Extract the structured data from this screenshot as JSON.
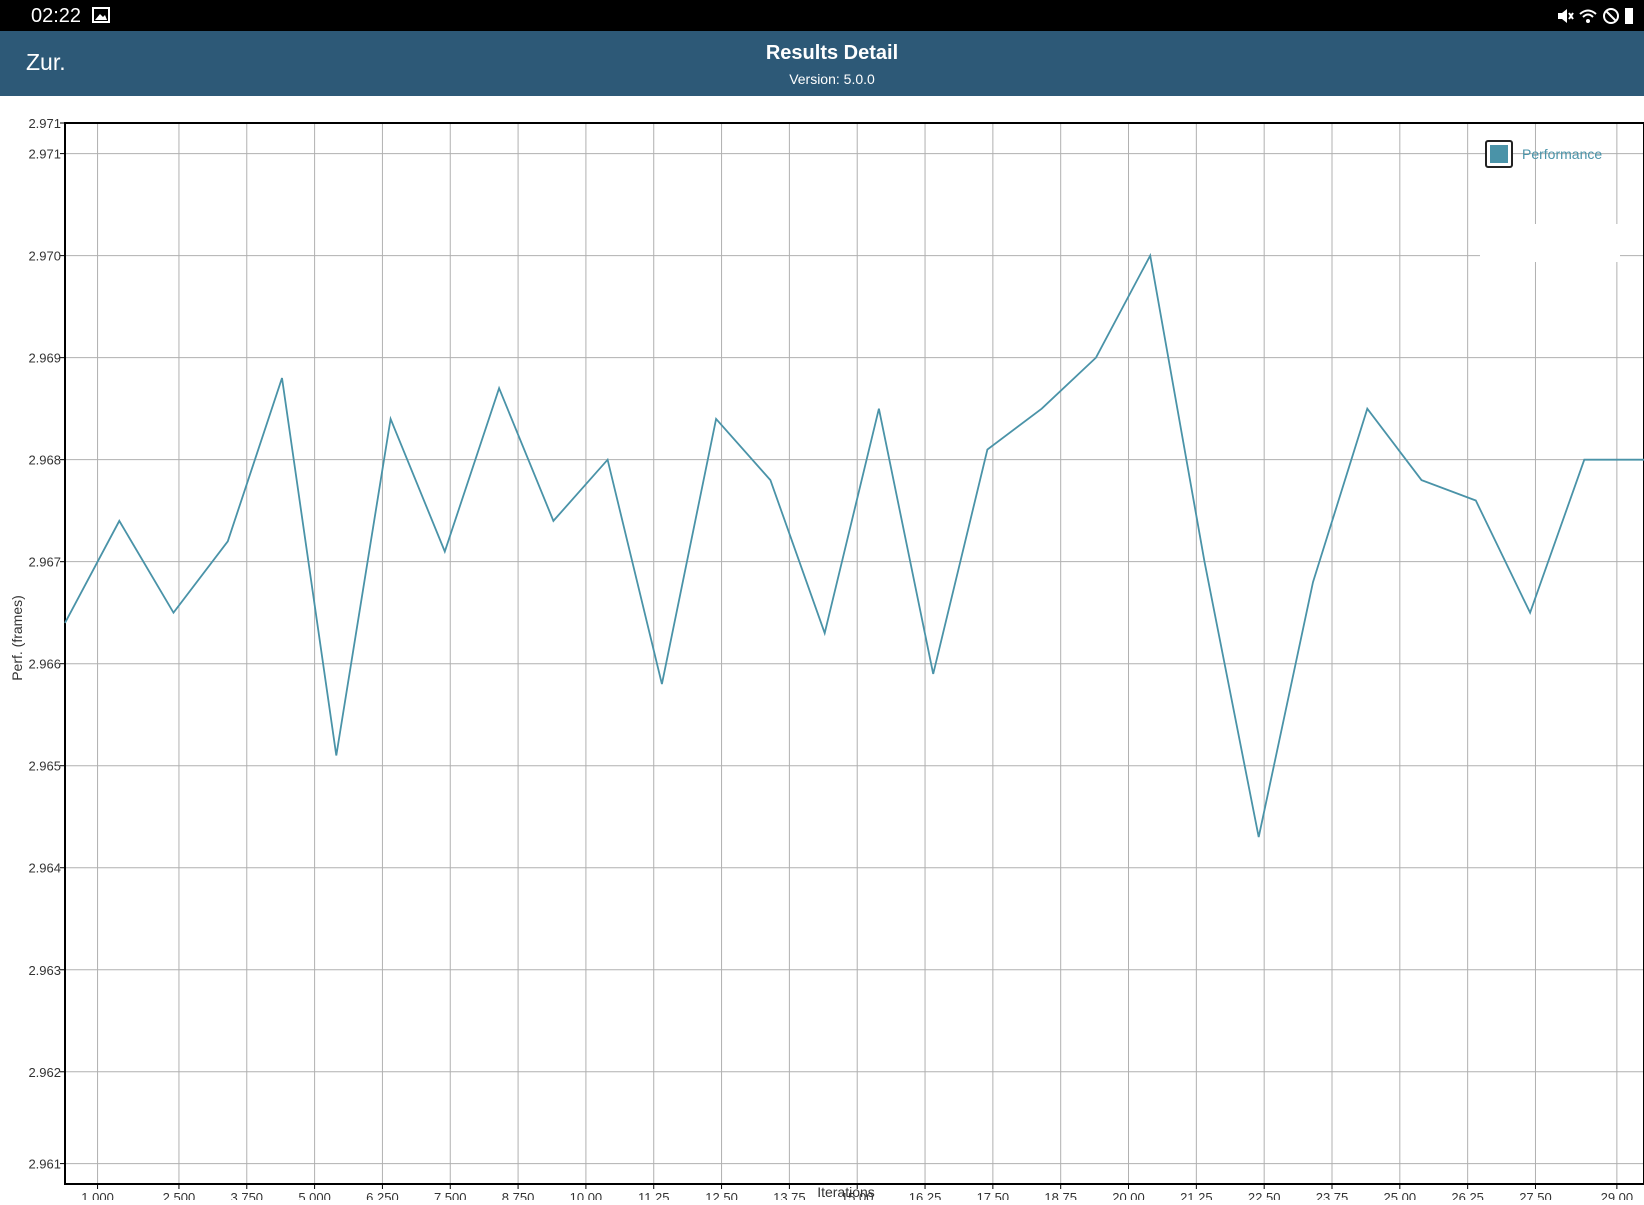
{
  "status_bar": {
    "time": "02:22",
    "left_icons": [
      "image-icon"
    ],
    "right_icons": [
      "mute-icon",
      "wifi-icon",
      "do-not-disturb-icon",
      "battery-icon"
    ]
  },
  "app_bar": {
    "back_label": "Zur.",
    "title": "Results Detail",
    "subtitle": "Version: 5.0.0",
    "background_color": "#2d5977"
  },
  "chart_data": {
    "type": "line",
    "xlabel": "Iterations",
    "ylabel": "Perf. (frames)",
    "xlim": [
      400,
      29500
    ],
    "ylim": [
      2.9609,
      2.9713
    ],
    "grid": true,
    "legend": {
      "position": "top-right",
      "entries": [
        "Performance"
      ]
    },
    "x_tick_values": [
      1000,
      2500,
      3750,
      5000,
      6250,
      7500,
      8750,
      10000,
      11250,
      12500,
      13750,
      15000,
      16250,
      17500,
      18750,
      20000,
      21250,
      22500,
      23750,
      25000,
      26250,
      27500,
      29000
    ],
    "x_tick_labels": [
      "1,000",
      "2,500",
      "3,750",
      "5,000",
      "6,250",
      "7,500",
      "8,750",
      "10,00",
      "11,25",
      "12,50",
      "13,75",
      "15,00",
      "16,25",
      "17,50",
      "18,75",
      "20,00",
      "21,25",
      "22,50",
      "23,75",
      "25,00",
      "26,25",
      "27,50",
      "29,00"
    ],
    "y_tick_values": [
      2.9611,
      2.962,
      2.963,
      2.964,
      2.965,
      2.966,
      2.967,
      2.968,
      2.969,
      2.97,
      2.971,
      2.9713
    ],
    "y_tick_labels": [
      "2.961",
      "2.962",
      "2.963",
      "2.964",
      "2.965",
      "2.966",
      "2.967",
      "2.968",
      "2.969",
      "2.970",
      "2.971",
      "2.971"
    ],
    "series": [
      {
        "name": "Performance",
        "color": "#4a93a8",
        "x": [
          400,
          1400,
          2400,
          3400,
          4400,
          5400,
          6400,
          7400,
          8400,
          9400,
          10400,
          11400,
          12400,
          13400,
          14400,
          15400,
          16400,
          17400,
          18400,
          19400,
          20400,
          21400,
          22400,
          23400,
          24400,
          25400,
          26400,
          27400,
          28400,
          29500
        ],
        "values": [
          2.9664,
          2.9674,
          2.9665,
          2.9672,
          2.9688,
          2.9651,
          2.9684,
          2.9671,
          2.9687,
          2.9674,
          2.968,
          2.9658,
          2.9684,
          2.9678,
          2.9663,
          2.9685,
          2.9659,
          2.9681,
          2.9685,
          2.969,
          2.97,
          2.967,
          2.9643,
          2.9668,
          2.9685,
          2.9678,
          2.9676,
          2.9665,
          2.968,
          2.968
        ]
      }
    ]
  }
}
